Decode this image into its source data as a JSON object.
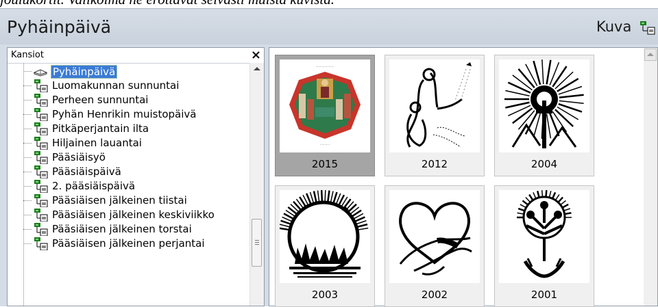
{
  "top_text": "joulukortit. Valikoima ne erottavat selvästi muista kuvista.",
  "app": {
    "title": "Pyhäinpäivä",
    "kuva_label": "Kuva"
  },
  "folders": {
    "title": "Kansiot",
    "close_label": "×",
    "items": [
      {
        "label": "Pyhäinpäivä",
        "icon": "open-book-icon",
        "selected": true
      },
      {
        "label": "Luomakunnan sunnuntai",
        "icon": "folder-node-icon"
      },
      {
        "label": "Perheen sunnuntai",
        "icon": "folder-node-icon"
      },
      {
        "label": "Pyhän Henrikin muistopäivä",
        "icon": "folder-node-icon"
      },
      {
        "label": "Pitkäperjantain ilta",
        "icon": "folder-node-icon"
      },
      {
        "label": "Hiljainen lauantai",
        "icon": "folder-node-icon"
      },
      {
        "label": "Pääsiäisyö",
        "icon": "folder-node-icon"
      },
      {
        "label": "Pääsiäispäivä",
        "icon": "folder-node-icon"
      },
      {
        "label": "2. pääsiäispäivä",
        "icon": "folder-node-icon"
      },
      {
        "label": "Pääsiäisen jälkeinen tiistai",
        "icon": "folder-node-icon"
      },
      {
        "label": "Pääsiäisen jälkeinen keskiviikko",
        "icon": "folder-node-icon"
      },
      {
        "label": "Pääsiäisen jälkeinen torstai",
        "icon": "folder-node-icon"
      },
      {
        "label": "Pääsiäisen jälkeinen perjantai",
        "icon": "folder-node-icon"
      }
    ]
  },
  "gallery": {
    "thumbnails": [
      {
        "caption": "2015",
        "selected": true,
        "image": "colored-icon-saints-card"
      },
      {
        "caption": "2012",
        "image": "figures-with-dove"
      },
      {
        "caption": "2004",
        "image": "radiant-sun-cross"
      },
      {
        "caption": "2003",
        "image": "rising-sun-hands"
      },
      {
        "caption": "2002",
        "image": "heart-with-hands"
      },
      {
        "caption": "2001",
        "image": "tree-in-hands"
      }
    ]
  },
  "colors": {
    "selection": "#3a7bd5",
    "window_bg": "#d4dce5",
    "thumb_selected": "#a5a5a5"
  }
}
